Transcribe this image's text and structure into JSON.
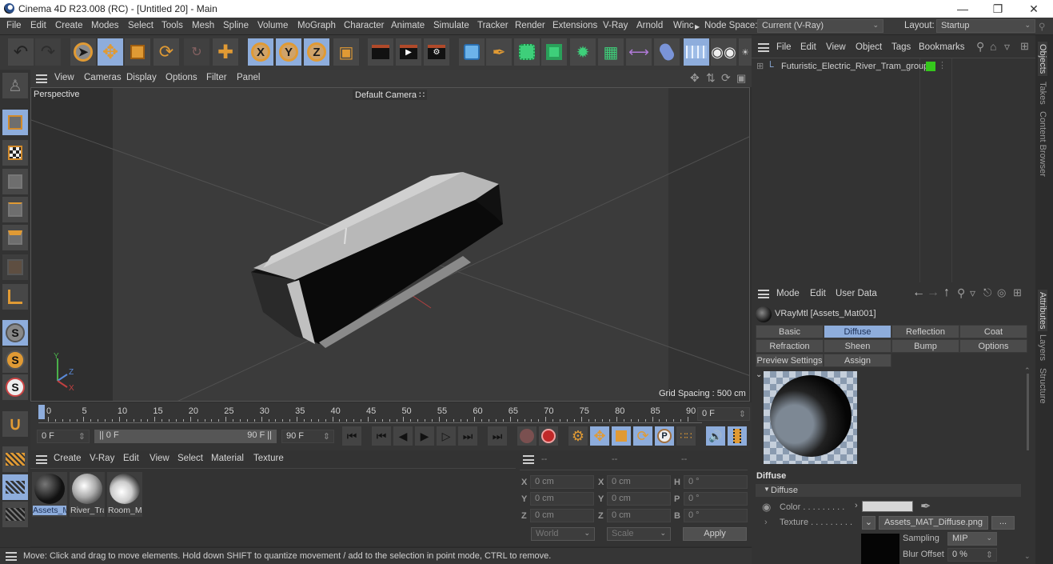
{
  "window": {
    "title": "Cinema 4D R23.008 (RC) - [Untitled 20] - Main",
    "controls": [
      "minimize",
      "restore",
      "close"
    ]
  },
  "menubar": {
    "items": [
      "File",
      "Edit",
      "Create",
      "Modes",
      "Select",
      "Tools",
      "Mesh",
      "Spline",
      "Volume",
      "MoGraph",
      "Character",
      "Animate",
      "Simulate",
      "Tracker",
      "Render",
      "Extensions",
      "V-Ray",
      "Arnold",
      "Winc"
    ],
    "node_space_label": "Node Space:",
    "node_space_value": "Current (V-Ray)",
    "layout_label": "Layout:",
    "layout_value": "Startup"
  },
  "toolbar": {
    "tools": [
      "undo-icon",
      "redo-icon",
      "live-selection-icon",
      "move-icon",
      "scale-icon",
      "rotate-icon",
      "recent-tools-icon",
      "create-tool-icon",
      "x-axis-lock",
      "y-axis-lock",
      "z-axis-lock",
      "coordinate-system-icon",
      "render-view-icon",
      "render-to-picture-viewer-icon",
      "render-settings-icon",
      "cube-icon",
      "pen-icon",
      "subdivision-surface-icon",
      "extrude-icon",
      "cloner-icon",
      "mograph-cloner-icon",
      "symmetry-icon",
      "deformer-icon",
      "floor-icon",
      "camera-icon"
    ],
    "axis_labels": [
      "X",
      "Y",
      "Z"
    ]
  },
  "left_tools": [
    "make-editable-icon",
    "texture-mode-icon",
    "points-mode-icon",
    "edges-mode-icon",
    "polygons-mode-icon",
    "uvw-mode-icon",
    "axis-mode-icon",
    "snap-icon",
    "snap-settings-icon",
    "solo-icon",
    "magnet-icon",
    "workplane-icon",
    "locked-workplane-icon",
    "planar-workplane-icon"
  ],
  "viewport": {
    "menu": [
      "View",
      "Cameras",
      "Display",
      "Options",
      "Filter",
      "Panel"
    ],
    "label": "Perspective",
    "camera": "Default Camera",
    "grid_spacing": "Grid Spacing : 500 cm",
    "axes": {
      "x": "X",
      "y": "Y",
      "z": "Z"
    }
  },
  "timeline": {
    "ticks": [
      "0",
      "5",
      "10",
      "15",
      "20",
      "25",
      "30",
      "35",
      "40",
      "45",
      "50",
      "55",
      "60",
      "65",
      "70",
      "75",
      "80",
      "85",
      "90"
    ],
    "current_frame": "0 F",
    "start_frame": "0 F",
    "range_start": "0 F",
    "range_end": "90 F",
    "end_frame": "90 F",
    "playhead_frame": 0,
    "max_frame": 90
  },
  "material_manager": {
    "menu": [
      "Create",
      "V-Ray",
      "Edit",
      "View",
      "Select",
      "Material",
      "Texture"
    ],
    "materials": [
      {
        "name": "Assets_M",
        "selected": true
      },
      {
        "name": "River_Tra",
        "selected": false
      },
      {
        "name": "Room_M",
        "selected": false
      }
    ]
  },
  "coordinates": {
    "headers": [
      "--",
      "--",
      "--"
    ],
    "position": [
      {
        "axis": "X",
        "value": "0 cm"
      },
      {
        "axis": "Y",
        "value": "0 cm"
      },
      {
        "axis": "Z",
        "value": "0 cm"
      }
    ],
    "size": [
      {
        "axis": "X",
        "value": "0 cm"
      },
      {
        "axis": "Y",
        "value": "0 cm"
      },
      {
        "axis": "Z",
        "value": "0 cm"
      }
    ],
    "rotation": [
      {
        "axis": "H",
        "value": "0 °"
      },
      {
        "axis": "P",
        "value": "0 °"
      },
      {
        "axis": "B",
        "value": "0 °"
      }
    ],
    "mode_dropdown": "World",
    "scale_dropdown": "Scale",
    "apply_label": "Apply"
  },
  "objects_panel": {
    "menu": [
      "File",
      "Edit",
      "View",
      "Object",
      "Tags",
      "Bookmarks"
    ],
    "objects": [
      {
        "name": "Futuristic_Electric_River_Tram_group",
        "color": "#35c81c"
      }
    ]
  },
  "attributes_panel": {
    "menu": [
      "Mode",
      "Edit",
      "User Data"
    ],
    "material_title": "VRayMtl [Assets_Mat001]",
    "tabs_row1": [
      "Basic",
      "Diffuse",
      "Reflection",
      "Coat"
    ],
    "tabs_row2": [
      "Refraction",
      "Sheen",
      "Bump",
      "Options"
    ],
    "tabs_row3": [
      "Preview Settings",
      "Assign"
    ],
    "active_tab": "Diffuse",
    "section_title": "Diffuse",
    "group_title": "Diffuse",
    "color_label": "Color . . . . . . . . .",
    "color_value": "#d8d8d8",
    "texture_label": "Texture . . . . . . . . .",
    "texture_file": "Assets_MAT_Diffuse.png",
    "texture_more": "...",
    "sampling_label": "Sampling",
    "sampling_value": "MIP",
    "blur_offset_label": "Blur Offset",
    "blur_offset_value": "0 %"
  },
  "side_tabs": {
    "top": [
      "Objects",
      "Takes",
      "Content Browser"
    ],
    "bottom": [
      "Attributes",
      "Layers",
      "Structure"
    ]
  },
  "statusbar": {
    "text": "Move: Click and drag to move elements. Hold down SHIFT to quantize movement / add to the selection in point mode, CTRL to remove."
  },
  "colors": {
    "accent": "#8eaddc",
    "tool_orange": "#e09a34",
    "object_tag_green": "#35c81c"
  }
}
